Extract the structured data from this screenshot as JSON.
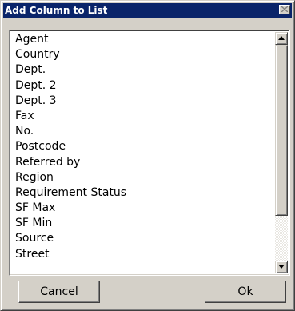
{
  "window": {
    "title": "Add Column to List",
    "close_icon": "close-icon",
    "titlebar_color": "#0a246a",
    "face_color": "#d4d0c8"
  },
  "list": {
    "items": [
      "Agent",
      "Country",
      "Dept.",
      "Dept. 2",
      "Dept. 3",
      "Fax",
      "No.",
      "Postcode",
      "Referred by",
      "Region",
      "Requirement Status",
      "SF Max",
      "SF Min",
      "Source",
      "Street"
    ],
    "scroll_up_icon": "scroll-up-arrow-icon",
    "scroll_down_icon": "scroll-down-arrow-icon"
  },
  "buttons": {
    "cancel_label": "Cancel",
    "ok_label": "Ok"
  }
}
